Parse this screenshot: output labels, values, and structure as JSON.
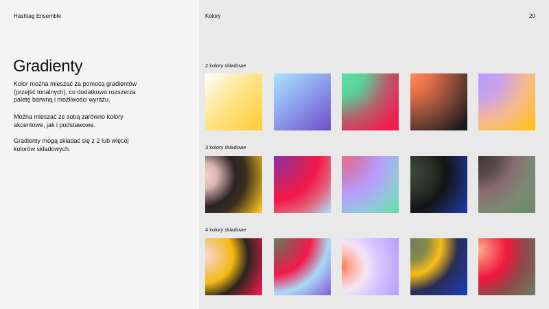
{
  "header": {
    "brand": "Hashtag Ensemble",
    "section": "Kolory",
    "page_number": "20"
  },
  "intro": {
    "title": "Gradienty",
    "paragraphs": [
      "Kolor można mieszać za pomocą gradientów (przejść tonalnych), co dodatkowo rozszerza paletę barwną i możliwości wyrazu.",
      "Można mieszać ze sobą zarówno kolory akcentowe, jak i podstawowe.",
      "Gradienty mogą składać się z 2 lub więcej kolorów składowych."
    ]
  },
  "groups": [
    {
      "label": "2 kolory składowe",
      "swatches": [
        {
          "colors": [
            "#fefdf3",
            "#ffcc33"
          ]
        },
        {
          "colors": [
            "#a9e3ff",
            "#6f4cc7"
          ]
        },
        {
          "colors": [
            "#5ee0a8",
            "#ef1f4e"
          ]
        },
        {
          "colors": [
            "#ff8a5a",
            "#1b1a1a"
          ]
        },
        {
          "colors": [
            "#b79cff",
            "#ffc21a"
          ]
        }
      ]
    },
    {
      "label": "3 kolory składowe",
      "swatches": [
        {
          "colors": [
            "#f6d3d1",
            "#2a2324",
            "#f2bf1c"
          ]
        },
        {
          "colors": [
            "#8d2fa8",
            "#f21748",
            "#a9e3ff"
          ]
        },
        {
          "colors": [
            "#f06a8a",
            "#b99cff",
            "#5ee0a8"
          ]
        },
        {
          "colors": [
            "#3e4a39",
            "#141414",
            "#1b3fb2"
          ]
        },
        {
          "colors": [
            "#3a3433",
            "#8a6c70",
            "#6e8a66"
          ]
        }
      ]
    },
    {
      "label": "4 kolory składowe",
      "swatches": [
        {
          "colors": [
            "#f9d8d6",
            "#f5b913",
            "#2a2421",
            "#eb1c45"
          ]
        },
        {
          "colors": [
            "#6b7d5e",
            "#f2194a",
            "#a9d9f5",
            "#8457d6"
          ]
        },
        {
          "colors": [
            "#ff7b4d",
            "#f4e6f4",
            "#d7c5ff",
            "#b99cff"
          ]
        },
        {
          "colors": [
            "#6b7d5e",
            "#f7be16",
            "#2a2d55",
            "#1a3bb0"
          ]
        },
        {
          "colors": [
            "#ffb08a",
            "#f1173f",
            "#8a4a4a",
            "#6f7f5f"
          ]
        }
      ]
    }
  ]
}
